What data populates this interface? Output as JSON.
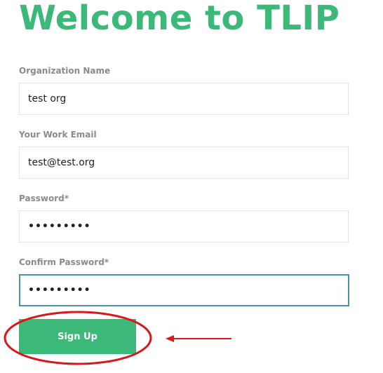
{
  "header": {
    "title": "Welcome to TLIP"
  },
  "form": {
    "org": {
      "label": "Organization Name",
      "value": "test org"
    },
    "email": {
      "label": "Your Work Email",
      "value": "test@test.org"
    },
    "password": {
      "label": "Password*",
      "value": "•••••••••"
    },
    "confirm": {
      "label": "Confirm Password*",
      "value": "•••••••••"
    },
    "submit_label": "Sign Up"
  },
  "colors": {
    "brand": "#3cb878",
    "label": "#8a8a8a",
    "focus_border": "#4e8fb0",
    "annotation": "#d7191c"
  },
  "annotation": {
    "shapes": [
      "red-ellipse",
      "red-arrow"
    ]
  }
}
